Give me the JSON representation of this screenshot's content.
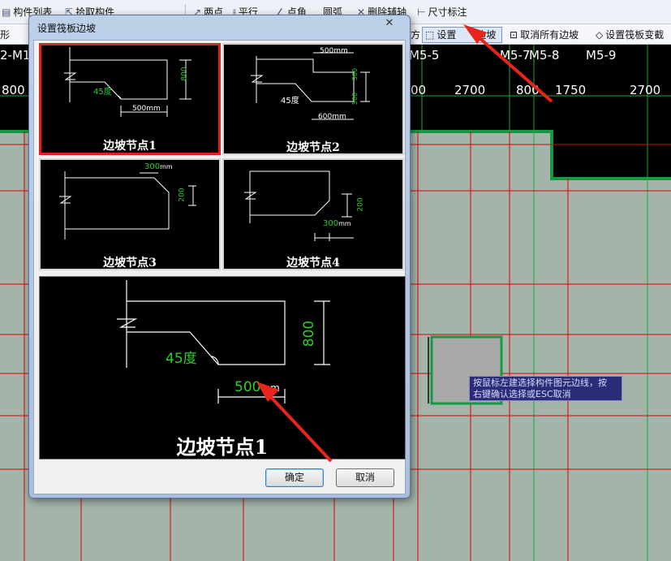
{
  "toolbar": {
    "component_list": "构件列表",
    "pick_component": "拾取构件",
    "two_point": "两点",
    "parallel": "平行",
    "point_angle": "点角",
    "circle_arc": "圆弧",
    "delete_aux_axis": "删除辅轴",
    "dimension_label": "尺寸标注"
  },
  "toolbar2": {
    "shape_partial": "形",
    "square_partial": "方",
    "set_slope_partial": "设置",
    "set_slope_end": "边坡",
    "cancel_all_slopes": "取消所有边坡",
    "set_raft_variable": "设置筏板变截"
  },
  "canvas": {
    "axis_labels": [
      "2-M1",
      "M5-5",
      "M5-7",
      "M5-8",
      "M5-9"
    ],
    "dimensions": [
      "800",
      "00",
      "2700",
      "800",
      "1750",
      "2700"
    ]
  },
  "tooltip": {
    "line1": "按鼠标左建选择构件图元边线，按",
    "line2": "右键确认选择或ESC取消"
  },
  "dialog": {
    "title": "设置筏板边坡",
    "close_glyph": "✕",
    "nodes": [
      {
        "label": "边坡节点1",
        "selected": true
      },
      {
        "label": "边坡节点2",
        "selected": false
      },
      {
        "label": "边坡节点3",
        "selected": false
      },
      {
        "label": "边坡节点4",
        "selected": false
      }
    ],
    "tile_annotations": {
      "n1_angle": "45度",
      "n1_width": "500",
      "n1_height": "800",
      "n2_top": "500",
      "n2_angle": "45度",
      "n2_bottom": "600",
      "n2_h1": "300",
      "n2_h2": "500",
      "n3_width": "300",
      "n3_height": "200",
      "n4_width": "300",
      "n4_height": "200",
      "unit": "mm"
    },
    "preview": {
      "label": "边坡节点1",
      "angle": "45度",
      "width": "500",
      "height": "800",
      "unit": "mm"
    },
    "ok_label": "确定",
    "cancel_label": "取消"
  },
  "colors": {
    "cad_green": "#22cc22",
    "grid_red": "#e00000",
    "arrow_red": "#e8251c",
    "selection_red": "#e02020"
  }
}
